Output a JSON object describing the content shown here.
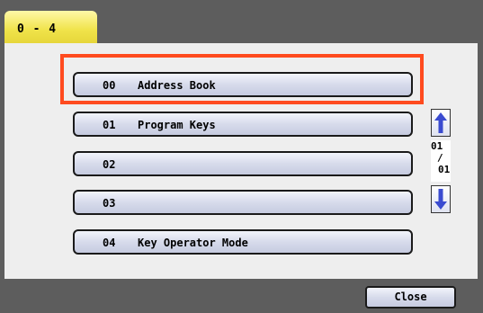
{
  "tab": {
    "label": "0 - 4"
  },
  "items": [
    {
      "number": "00",
      "label": "Address Book",
      "selected": true
    },
    {
      "number": "01",
      "label": "Program Keys"
    },
    {
      "number": "02",
      "label": ""
    },
    {
      "number": "03",
      "label": ""
    },
    {
      "number": "04",
      "label": "Key Operator Mode"
    }
  ],
  "pager": {
    "current": "01",
    "separator": "/",
    "total": "01"
  },
  "footer": {
    "close_label": "Close"
  },
  "colors": {
    "highlight": "#ff4b1f",
    "tab": "#f0e34a",
    "button_fill": "#d7dbeb",
    "scroll_arrow": "#3a4bd0"
  }
}
